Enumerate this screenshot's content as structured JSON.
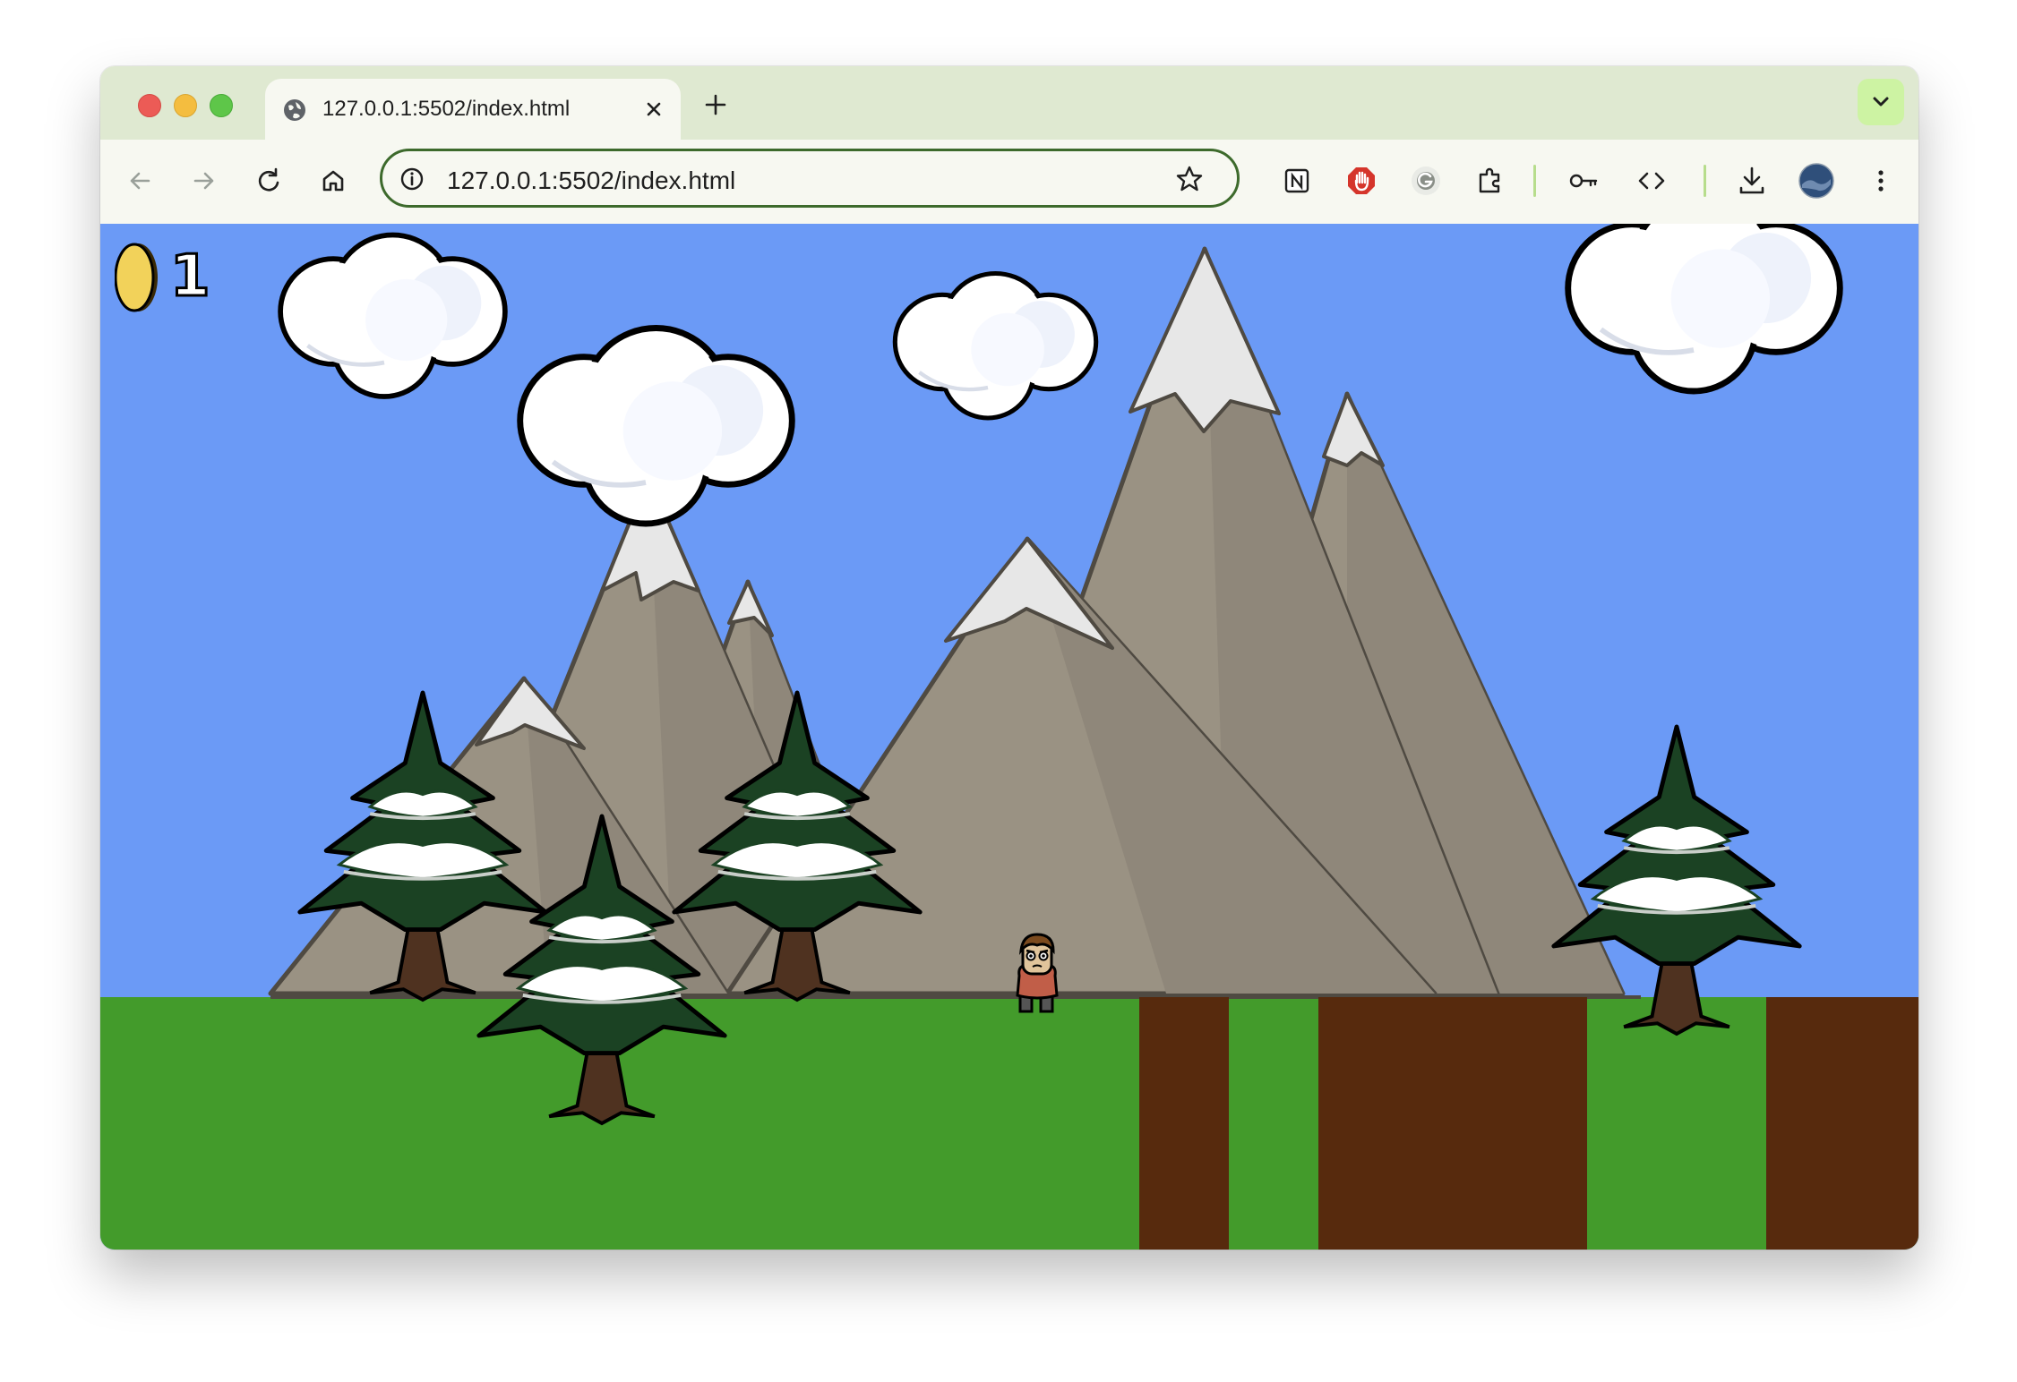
{
  "browser": {
    "tab_title": "127.0.0.1:5502/index.html",
    "url": "127.0.0.1:5502/index.html",
    "toolbar_icons": [
      "back-icon",
      "forward-icon",
      "reload-icon",
      "home-icon",
      "notion-extension-icon",
      "adblock-extension-icon",
      "grammarly-extension-icon",
      "extensions-icon",
      "password-key-icon",
      "devtools-code-icon",
      "download-icon",
      "profile-avatar",
      "menu-icon"
    ]
  },
  "game": {
    "hud": {
      "coin_count": "1"
    },
    "colors": {
      "sky": "#6b9af6",
      "grass": "#439b2b",
      "dirt": "#572a0d",
      "mountain": "#9a9283",
      "tree": "#1b4223",
      "coin": "#f2d25a"
    }
  }
}
